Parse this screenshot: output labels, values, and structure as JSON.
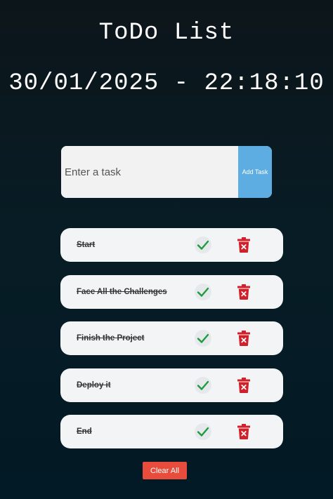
{
  "app": {
    "title": "ToDo List",
    "datetime": "30/01/2025 - 22:18:10"
  },
  "input": {
    "placeholder": "Enter a task",
    "value": "",
    "add_label": "Add Task"
  },
  "tasks": [
    {
      "text": "Start",
      "completed": true
    },
    {
      "text": "Face All the Challenges",
      "completed": true
    },
    {
      "text": "Finish the Project",
      "completed": true
    },
    {
      "text": "Deploy it",
      "completed": true
    },
    {
      "text": "End",
      "completed": true
    }
  ],
  "actions": {
    "clear_label": "Clear All"
  },
  "icons": {
    "complete": "check-icon",
    "delete": "trash-icon"
  },
  "colors": {
    "accent": "#5dade2",
    "check": "#1e9b3c",
    "delete": "#d0202a",
    "clear_button": "#e74c3c"
  }
}
